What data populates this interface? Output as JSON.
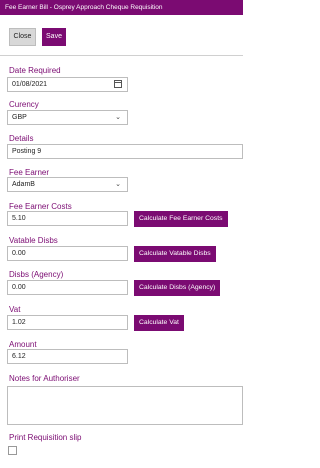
{
  "window": {
    "title": "Fee Earner Bill - Osprey Approach Cheque Requisition"
  },
  "toolbar": {
    "close_label": "Close",
    "save_label": "Save"
  },
  "form": {
    "date_required": {
      "label": "Date Required",
      "value": "01/08/2021"
    },
    "currency": {
      "label": "Curency",
      "value": "GBP"
    },
    "details": {
      "label": "Details",
      "value": "Posting 9"
    },
    "fee_earner": {
      "label": "Fee Earner",
      "value": "AdamB"
    },
    "fee_earner_costs": {
      "label": "Fee Earner Costs",
      "value": "5.10",
      "button": "Calculate Fee Earner Costs"
    },
    "vatable_disbs": {
      "label": "Vatable Disbs",
      "value": "0.00",
      "button": "Calculate Vatable Disbs"
    },
    "disbs_agency": {
      "label": "Disbs (Agency)",
      "value": "0.00",
      "button": "Calculate Disbs (Agency)"
    },
    "vat": {
      "label": "Vat",
      "value": "1.02",
      "button": "Calculate Vat"
    },
    "amount": {
      "label": "Amount",
      "value": "6.12"
    },
    "notes": {
      "label": "Notes for Authoriser",
      "value": ""
    },
    "print_slip": {
      "label": "Print Requisition slip",
      "checked": false
    }
  },
  "icons": {
    "dropdown": "chevron-down-icon",
    "calendar": "calendar-icon"
  },
  "colors": {
    "accent": "#7b0b72",
    "button_neutral": "#d8d8d8"
  }
}
